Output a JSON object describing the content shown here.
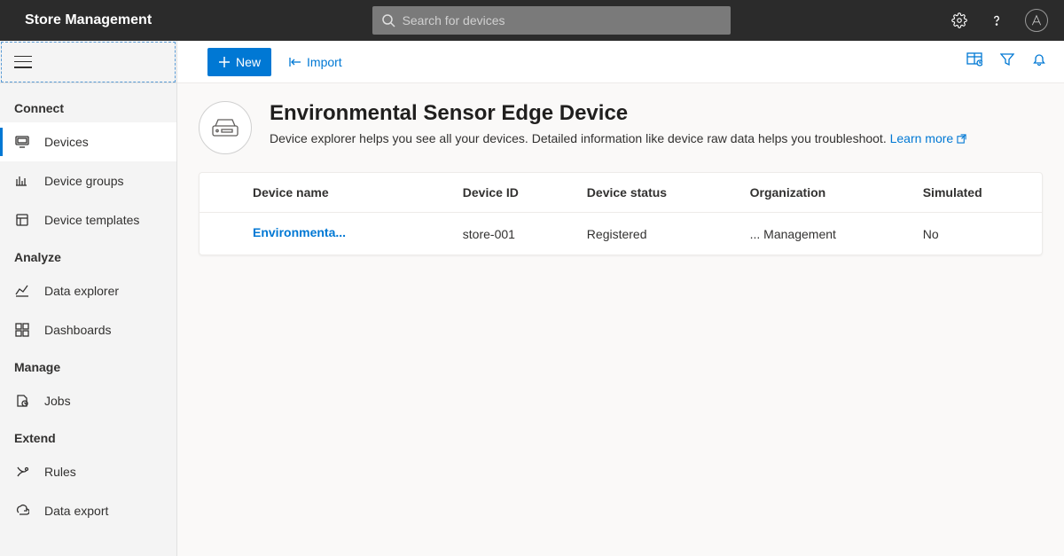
{
  "header": {
    "app_title": "Store Management",
    "search_placeholder": "Search for devices",
    "avatar_initial": "A"
  },
  "sidebar": {
    "sections": {
      "connect": {
        "label": "Connect",
        "items": [
          "Devices",
          "Device groups",
          "Device templates"
        ]
      },
      "analyze": {
        "label": "Analyze",
        "items": [
          "Data explorer",
          "Dashboards"
        ]
      },
      "manage": {
        "label": "Manage",
        "items": [
          "Jobs"
        ]
      },
      "extend": {
        "label": "Extend",
        "items": [
          "Rules",
          "Data export"
        ]
      }
    }
  },
  "commands": {
    "new": "New",
    "import": "Import"
  },
  "page": {
    "title": "Environmental Sensor Edge Device",
    "description": "Device explorer helps you see all your devices. Detailed information like device raw data helps you troubleshoot. ",
    "learn_more": "Learn more"
  },
  "table": {
    "columns": [
      "Device name",
      "Device ID",
      "Device status",
      "Organization",
      "Simulated"
    ],
    "rows": [
      {
        "name": "Environmenta...",
        "id": "store-001",
        "status": "Registered",
        "organization": "... Management",
        "simulated": "No"
      }
    ]
  }
}
